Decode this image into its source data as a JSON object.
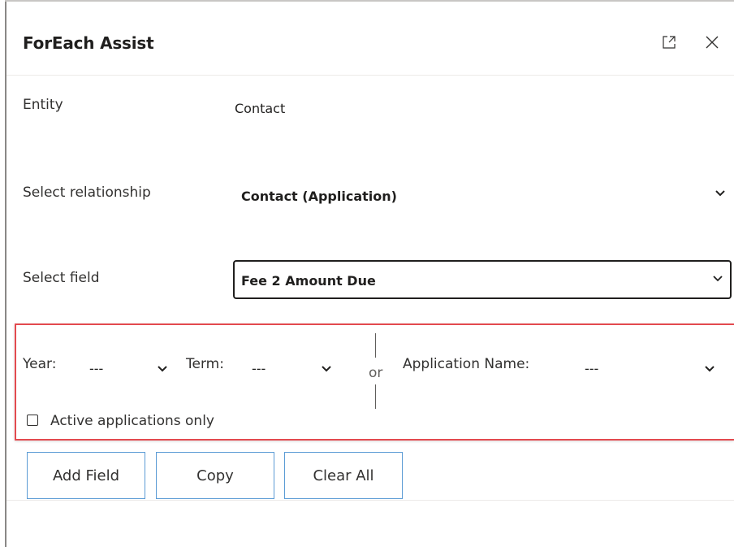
{
  "dialog": {
    "title": "ForEach Assist",
    "expand_icon": "expand-icon",
    "close_icon": "close-icon"
  },
  "form": {
    "entity": {
      "label": "Entity",
      "value": "Contact"
    },
    "relationship": {
      "label": "Select relationship",
      "value": "Contact (Application)"
    },
    "field": {
      "label": "Select field",
      "value": "Fee 2 Amount Due"
    }
  },
  "filters": {
    "year": {
      "label": "Year:",
      "value": "---"
    },
    "term": {
      "label": "Term:",
      "value": "---"
    },
    "or_label": "or",
    "application_name": {
      "label": "Application Name:",
      "value": "---"
    },
    "active_only": {
      "label": "Active applications only",
      "checked": false
    },
    "highlight_color": "#e34a4f"
  },
  "buttons": {
    "add_field": "Add Field",
    "copy": "Copy",
    "clear_all": "Clear All",
    "border_color": "#5b9bd5"
  }
}
